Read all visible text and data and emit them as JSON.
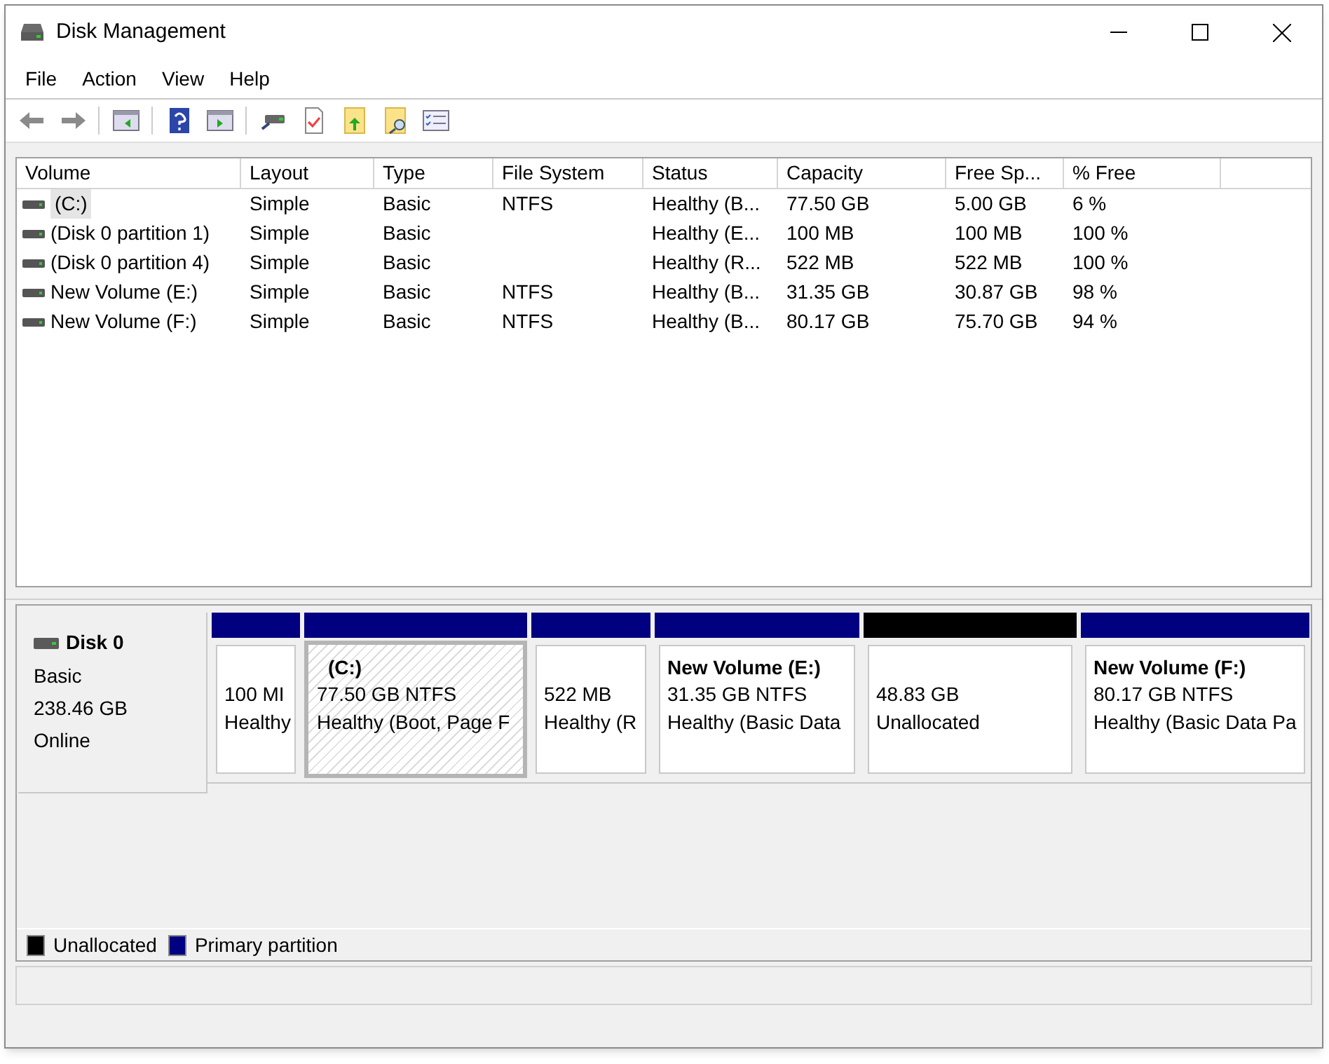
{
  "window": {
    "title": "Disk Management"
  },
  "menu": [
    "File",
    "Action",
    "View",
    "Help"
  ],
  "table": {
    "columns": [
      "Volume",
      "Layout",
      "Type",
      "File System",
      "Status",
      "Capacity",
      "Free Sp...",
      "% Free"
    ],
    "rows": [
      {
        "selected": true,
        "cells": [
          "(C:)",
          "Simple",
          "Basic",
          "NTFS",
          "Healthy (B...",
          "77.50 GB",
          "5.00 GB",
          "6 %"
        ]
      },
      {
        "selected": false,
        "cells": [
          "(Disk 0 partition 1)",
          "Simple",
          "Basic",
          "",
          "Healthy (E...",
          "100 MB",
          "100 MB",
          "100 %"
        ]
      },
      {
        "selected": false,
        "cells": [
          "(Disk 0 partition 4)",
          "Simple",
          "Basic",
          "",
          "Healthy (R...",
          "522 MB",
          "522 MB",
          "100 %"
        ]
      },
      {
        "selected": false,
        "cells": [
          "New Volume (E:)",
          "Simple",
          "Basic",
          "NTFS",
          "Healthy (B...",
          "31.35 GB",
          "30.87 GB",
          "98 %"
        ]
      },
      {
        "selected": false,
        "cells": [
          "New Volume (F:)",
          "Simple",
          "Basic",
          "NTFS",
          "Healthy (B...",
          "80.17 GB",
          "75.70 GB",
          "94 %"
        ]
      }
    ]
  },
  "disk": {
    "name": "Disk 0",
    "type": "Basic",
    "size": "238.46 GB",
    "state": "Online",
    "partitions": [
      {
        "kind": "primary",
        "selected": false,
        "size": "100 MI",
        "status": "Healthy"
      },
      {
        "kind": "primary",
        "selected": true,
        "title": "(C:)",
        "size": "77.50 GB NTFS",
        "status": "Healthy (Boot, Page F"
      },
      {
        "kind": "primary",
        "selected": false,
        "size": "522 MB",
        "status": "Healthy (R"
      },
      {
        "kind": "primary",
        "selected": false,
        "title": "New Volume  (E:)",
        "size": "31.35 GB NTFS",
        "status": "Healthy (Basic Data"
      },
      {
        "kind": "unallocated",
        "selected": false,
        "size": "48.83 GB",
        "status": "Unallocated"
      },
      {
        "kind": "primary",
        "selected": false,
        "title": "New Volume  (F:)",
        "size": "80.17 GB NTFS",
        "status": "Healthy (Basic Data Pa"
      }
    ]
  },
  "legend": [
    {
      "label": "Unallocated",
      "color": "#000000"
    },
    {
      "label": "Primary partition",
      "color": "#000080"
    }
  ]
}
